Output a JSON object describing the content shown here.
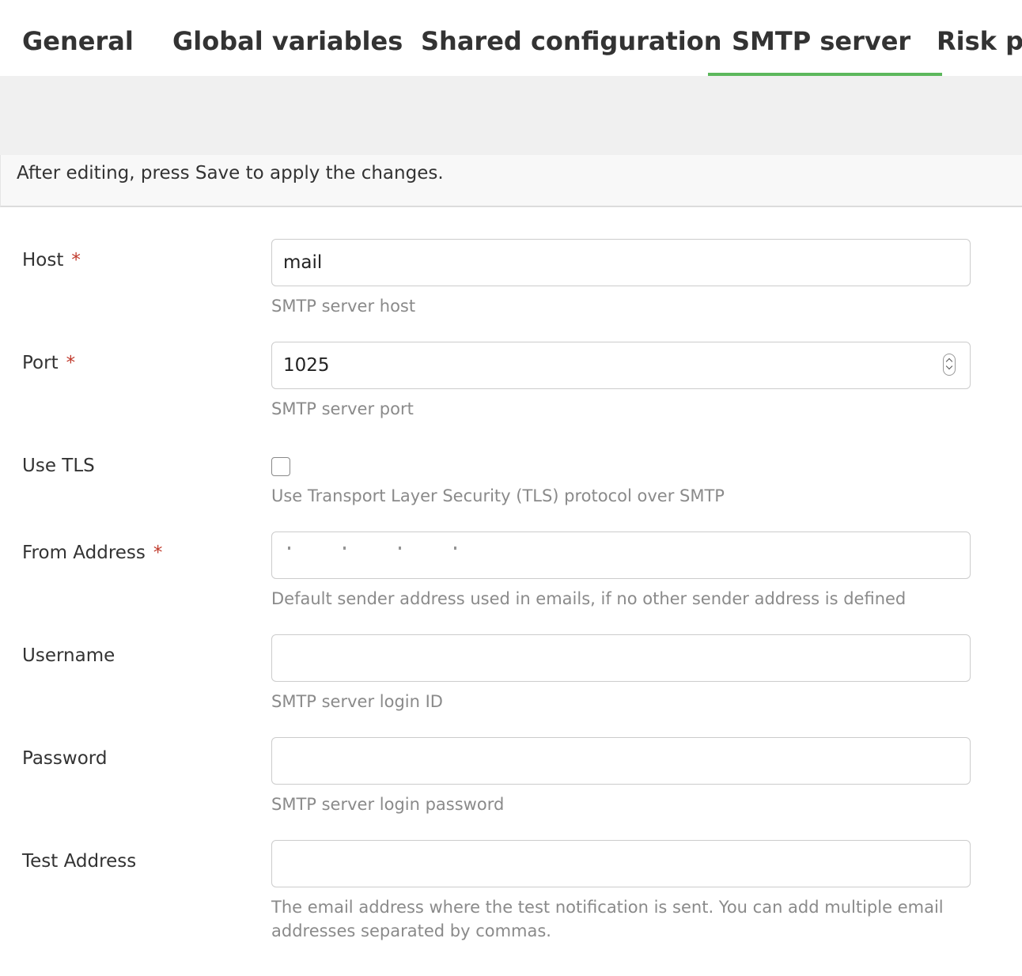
{
  "tabs": [
    {
      "label": "General"
    },
    {
      "label": "Global variables"
    },
    {
      "label": "Shared configuration"
    },
    {
      "label": "SMTP server",
      "active": true
    },
    {
      "label": "Risk pro"
    }
  ],
  "notice": "After editing, press Save to apply the changes.",
  "form": {
    "host": {
      "label": "Host",
      "required": "*",
      "value": "mail",
      "help": "SMTP server host"
    },
    "port": {
      "label": "Port",
      "required": "*",
      "value": "1025",
      "help": "SMTP server port"
    },
    "tls": {
      "label": "Use TLS",
      "checked": false,
      "help": "Use Transport Layer Security (TLS) protocol over SMTP"
    },
    "from": {
      "label": "From Address",
      "required": "*",
      "help": "Default sender address used in emails, if no other sender address is defined"
    },
    "username": {
      "label": "Username",
      "value": "",
      "help": "SMTP server login ID"
    },
    "password": {
      "label": "Password",
      "value": "",
      "help": "SMTP server login password"
    },
    "test": {
      "label": "Test Address",
      "value": "",
      "help": "The email address where the test notification is sent. You can add multiple email addresses separated by commas."
    }
  },
  "colors": {
    "accent": "#5cb85c",
    "required": "#c0392b"
  }
}
